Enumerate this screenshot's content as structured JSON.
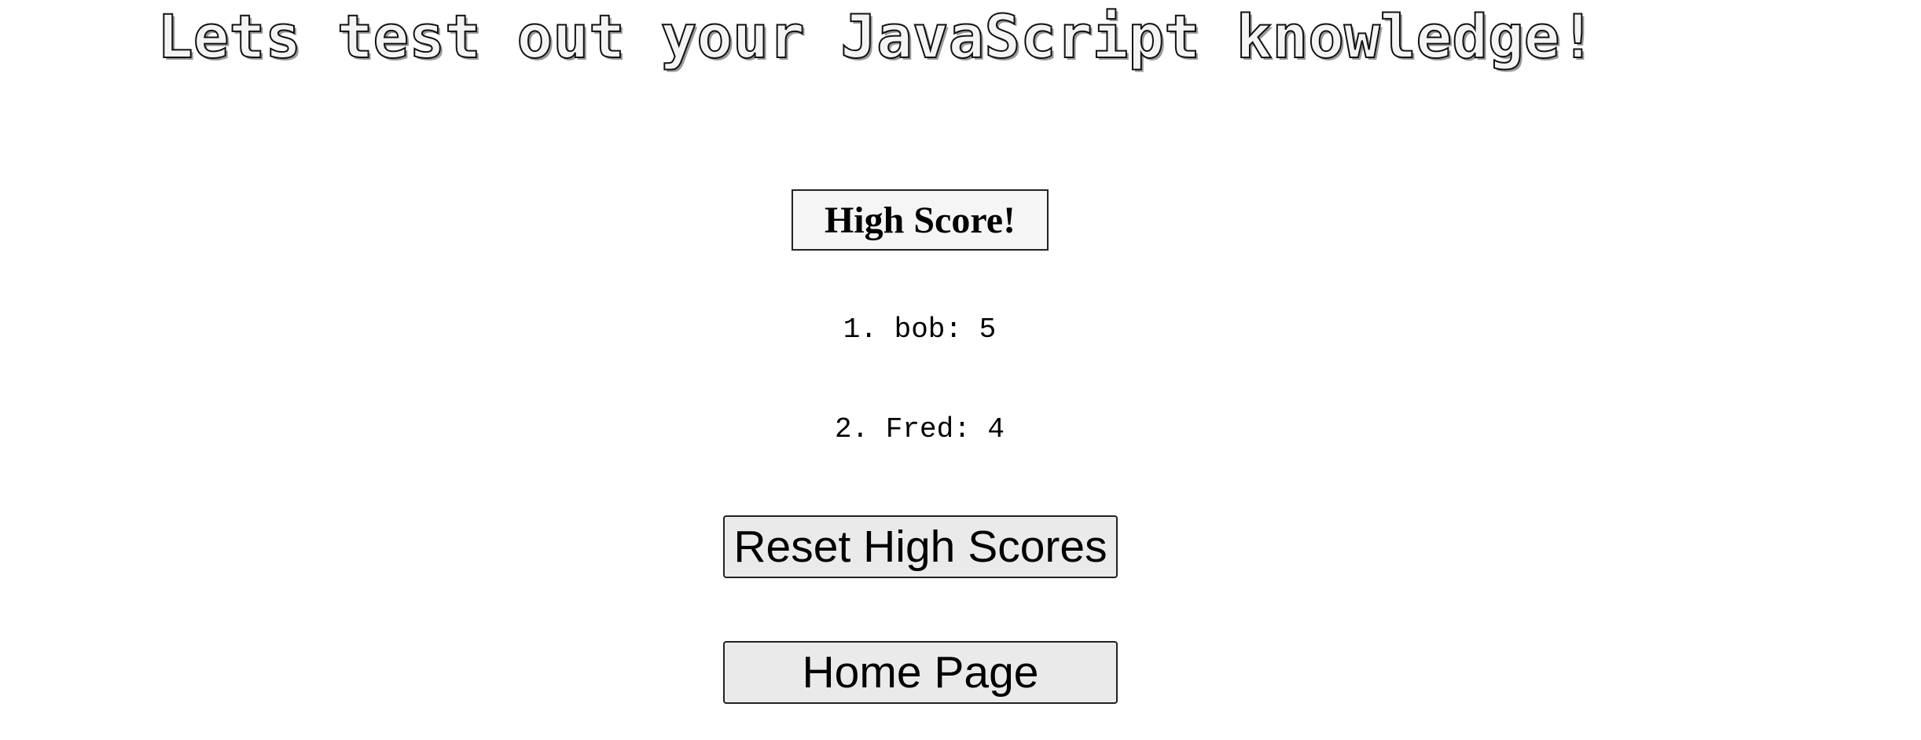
{
  "header": {
    "title": "Lets test out your JavaScript knowledge!"
  },
  "scoreboard": {
    "heading": "High Score!",
    "entries": [
      "1. bob: 5",
      "2. Fred: 4"
    ]
  },
  "actions": {
    "reset_label": "Reset High Scores",
    "home_label": "Home Page"
  }
}
